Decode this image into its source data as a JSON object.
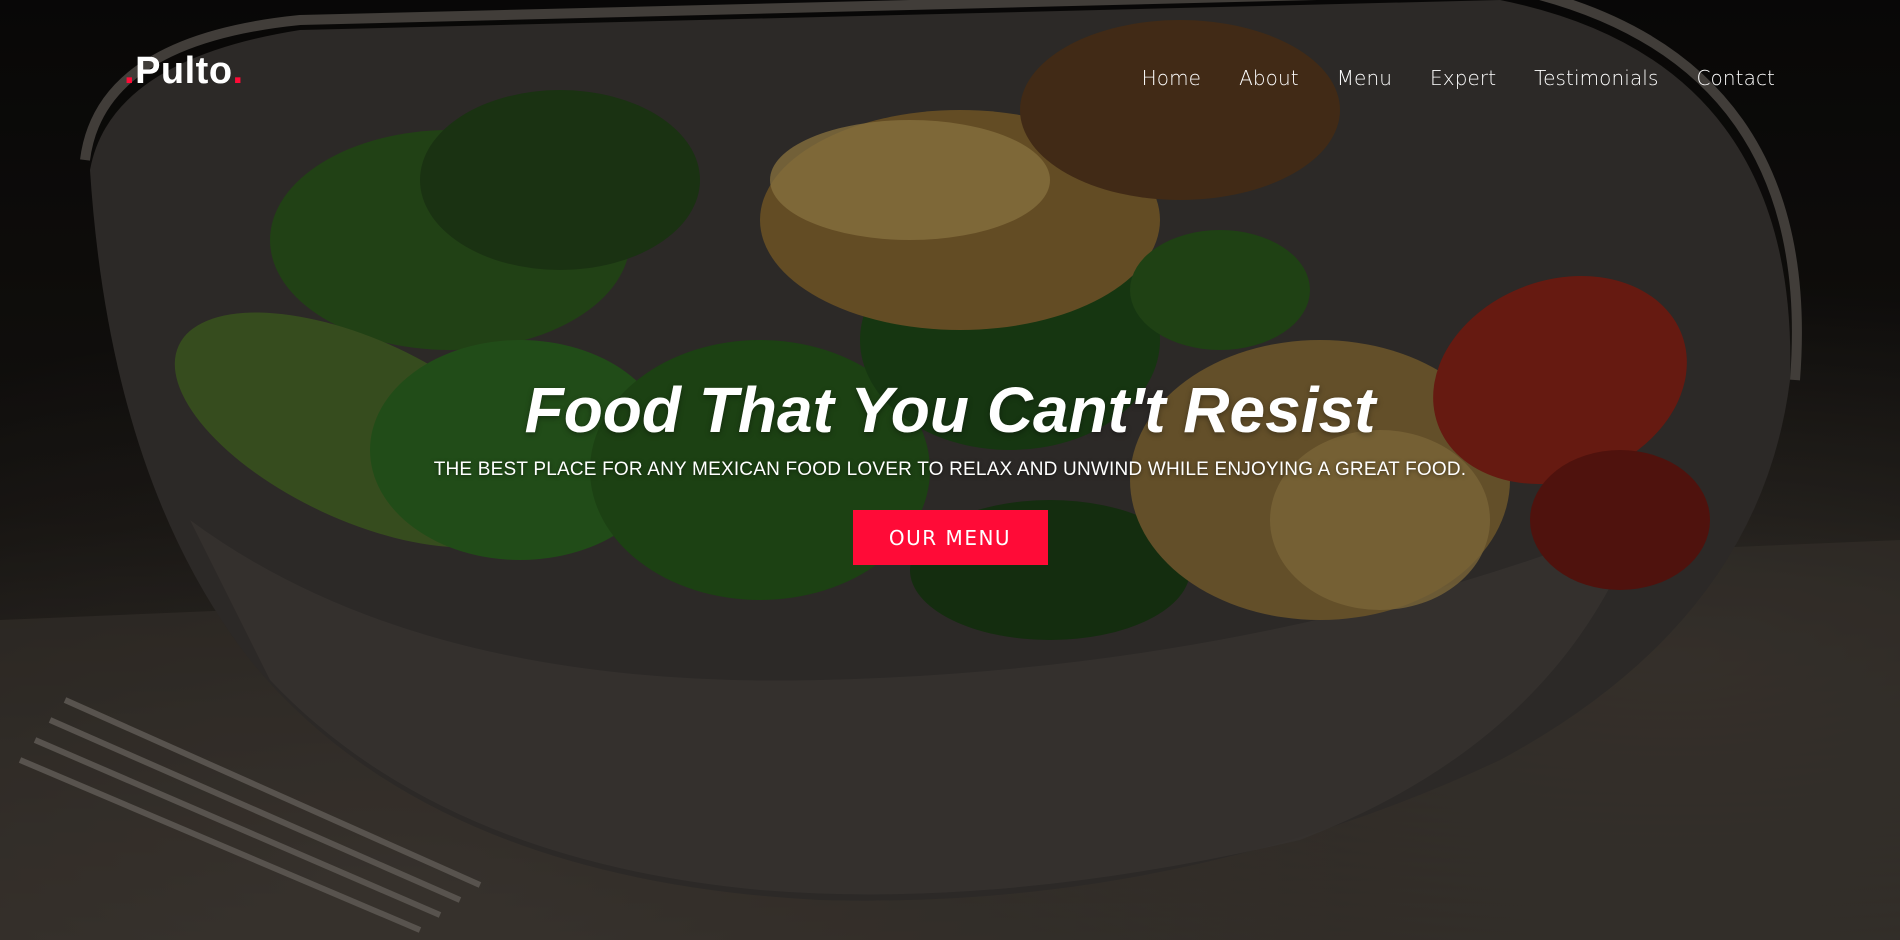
{
  "brand": {
    "name": "Pulto",
    "dot": ".",
    "accent_color": "#ff0b37"
  },
  "nav": {
    "items": [
      {
        "label": "Home"
      },
      {
        "label": "About"
      },
      {
        "label": "Menu"
      },
      {
        "label": "Expert"
      },
      {
        "label": "Testimonials"
      },
      {
        "label": "Contact"
      }
    ]
  },
  "hero": {
    "title": "Food That You Cant't Resist",
    "subtitle": "THE BEST PLACE FOR ANY MEXICAN FOOD LOVER TO RELAX AND UNWIND WHILE ENJOYING A GREAT FOOD.",
    "cta_label": "OUR MENU",
    "background_image": "salad-bowl-photo"
  }
}
